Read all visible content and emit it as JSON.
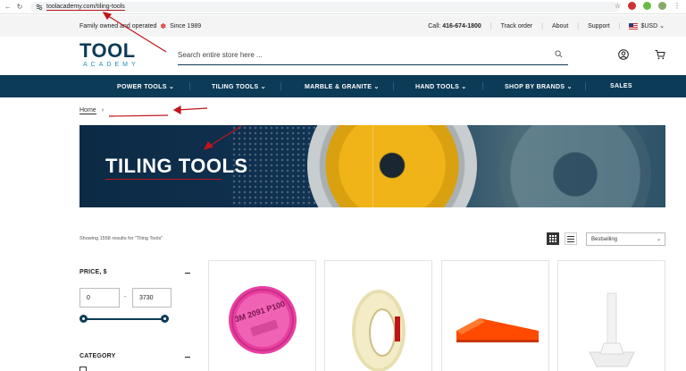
{
  "browser": {
    "url": "toolacademy.com/tiling-tools"
  },
  "topbar": {
    "tagline_prefix": "Family owned and operated",
    "tagline_suffix": "Since 1989",
    "call_label": "Call:",
    "phone": "416-674-1800",
    "links": [
      "Track order",
      "About",
      "Support"
    ],
    "currency": "$USD"
  },
  "header": {
    "logo_main": "TOOL",
    "logo_sub": "ACADEMY",
    "search_placeholder": "Search entire store here ..."
  },
  "nav": {
    "items": [
      {
        "label": "POWER TOOLS"
      },
      {
        "label": "TILING TOOLS"
      },
      {
        "label": "MARBLE & GRANITE"
      },
      {
        "label": "HAND TOOLS"
      },
      {
        "label": "SHOP BY BRANDS"
      },
      {
        "label": "SALES"
      }
    ]
  },
  "breadcrumb": {
    "home": "Home",
    "separator": "›"
  },
  "hero": {
    "title": "TILING TOOLS"
  },
  "listing": {
    "results_text": "Showing 1558 results for \"Tiling Tools\"",
    "sort_selected": "Bestselling"
  },
  "filters": {
    "price_title": "PRICE, $",
    "price_min": "0",
    "price_max": "3730",
    "range_dash": "-",
    "category_title": "CATEGORY"
  },
  "products": [
    {
      "image": "pink-filter-cartridge",
      "print": "3M 2091 P100"
    },
    {
      "image": "masking-tape-roll"
    },
    {
      "image": "orange-tile-wedge"
    },
    {
      "image": "white-tile-leveling-spacer"
    }
  ],
  "colors": {
    "brand_navy": "#0c3b57",
    "brand_blue": "#1f8fb8",
    "annotation_red": "#c0141b"
  }
}
